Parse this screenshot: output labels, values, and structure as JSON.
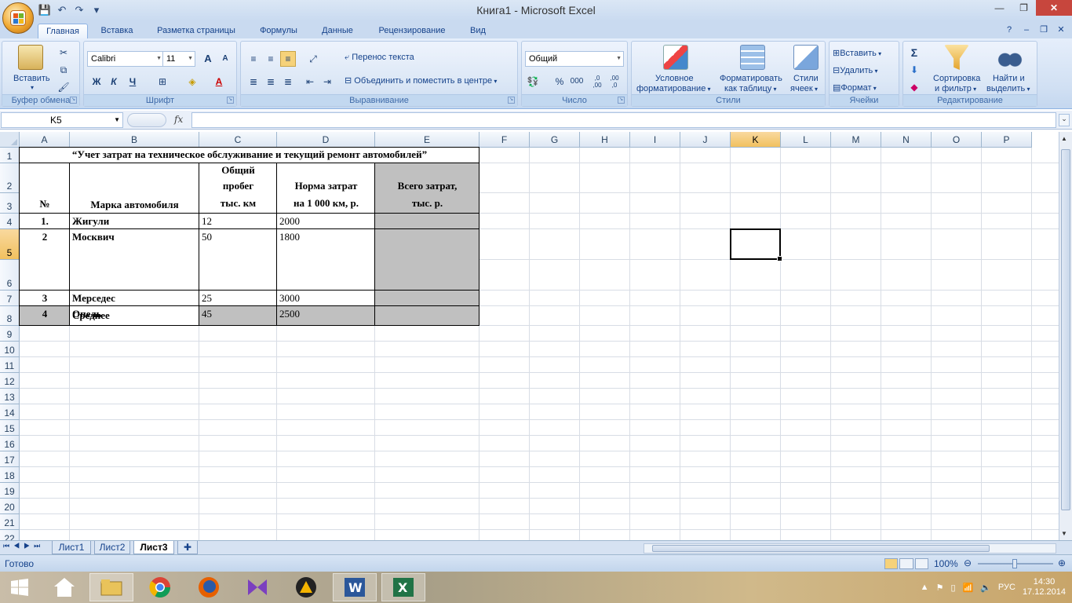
{
  "window": {
    "title": "Книга1 - Microsoft Excel"
  },
  "ribbon_tabs": [
    "Главная",
    "Вставка",
    "Разметка страницы",
    "Формулы",
    "Данные",
    "Рецензирование",
    "Вид"
  ],
  "clipboard": {
    "paste": "Вставить",
    "group": "Буфер обмена"
  },
  "font": {
    "name": "Calibri",
    "size": "11",
    "bold": "Ж",
    "italic": "К",
    "underline": "Ч",
    "grow": "A",
    "shrink": "A",
    "color_a": "A",
    "group": "Шрифт"
  },
  "alignment": {
    "wrap": "Перенос текста",
    "merge": "Объединить и поместить в центре",
    "group": "Выравнивание"
  },
  "number": {
    "format": "Общий",
    "percent": "%",
    "thousands": "000",
    "inc_dec": ",0 ,00",
    "dec_dec": ",00 ,0",
    "group": "Число"
  },
  "styles": {
    "conditional": "Условное",
    "conditional2": "форматирование",
    "format_table": "Форматировать",
    "format_table2": "как таблицу",
    "cell_styles": "Стили",
    "cell_styles2": "ячеек",
    "group": "Стили"
  },
  "cells": {
    "insert": "Вставить",
    "delete": "Удалить",
    "format": "Формат",
    "group": "Ячейки"
  },
  "editing": {
    "sigma": "Σ",
    "sort": "Сортировка",
    "sort2": "и фильтр",
    "find": "Найти и",
    "find2": "выделить",
    "group": "Редактирование"
  },
  "formula_bar": {
    "name_box": "K5",
    "fx": "fx",
    "value": ""
  },
  "columns": [
    "A",
    "B",
    "C",
    "D",
    "E",
    "F",
    "G",
    "H",
    "I",
    "J",
    "K",
    "L",
    "M",
    "N",
    "O",
    "P"
  ],
  "rows": [
    "1",
    "2",
    "3",
    "4",
    "5",
    "6",
    "7",
    "8",
    "9",
    "10",
    "11",
    "12",
    "13",
    "14",
    "15",
    "16",
    "17",
    "18",
    "19",
    "20",
    "21",
    "22"
  ],
  "sheet": {
    "title": "“Учет затрат на техническое обслуживание и текущий ремонт автомобилей”",
    "h_no": "№",
    "h_brand": "Марка автомобиля",
    "h_mileage1": "Общий",
    "h_mileage2": "пробег",
    "h_mileage3": "тыс. км",
    "h_norm1": "Норма затрат",
    "h_norm2": "на 1 000 км, р.",
    "h_total1": "Всего затрат,",
    "h_total2": "тыс. р.",
    "rows": [
      {
        "no": "1.",
        "brand": "Жигули",
        "mileage": "12",
        "norm": "2000"
      },
      {
        "no": "2",
        "brand": "Москвич",
        "mileage": "50",
        "norm": "1800"
      },
      {
        "no": "3",
        "brand": "Мерседес",
        "mileage": "25",
        "norm": "3000"
      },
      {
        "no": "4",
        "brand": "Опель",
        "mileage": "45",
        "norm": "2500"
      }
    ],
    "avg": "Среднее"
  },
  "sheet_tabs": [
    "Лист1",
    "Лист2",
    "Лист3"
  ],
  "status": {
    "ready": "Готово",
    "zoom": "100%"
  },
  "tray": {
    "lang": "РУС",
    "time": "14:30",
    "date": "17.12.2014"
  }
}
